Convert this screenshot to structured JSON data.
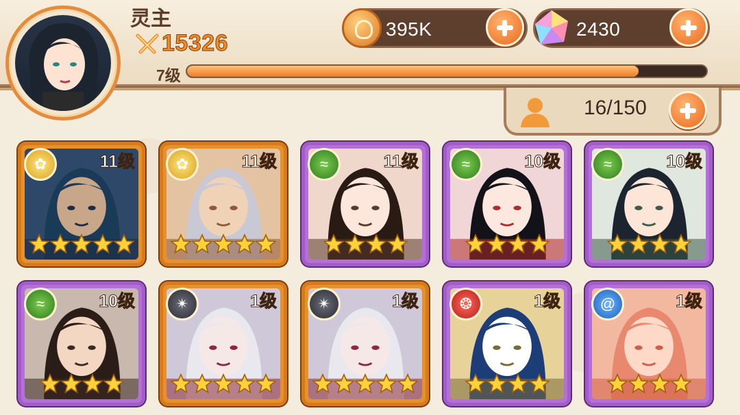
{
  "player": {
    "name": "灵主",
    "power": "15326",
    "level": "7级",
    "xp_fraction": 0.87
  },
  "resources": {
    "coins": "395K",
    "gems": "2430",
    "heroes": "16/150"
  },
  "colors": {
    "accent": "#ee7a26",
    "orange_frame": "#e7912d",
    "purple_frame": "#b56fd8"
  },
  "heroes": [
    {
      "level": "11级",
      "stars": 5,
      "frame": "orange",
      "faction": "gold-rose"
    },
    {
      "level": "11级",
      "stars": 5,
      "frame": "orange",
      "faction": "gold-rose"
    },
    {
      "level": "11级",
      "stars": 4,
      "frame": "purple",
      "faction": "green-leaf"
    },
    {
      "level": "10级",
      "stars": 4,
      "frame": "purple",
      "faction": "green-leaf"
    },
    {
      "level": "10级",
      "stars": 4,
      "frame": "purple",
      "faction": "green-leaf"
    },
    {
      "level": "10级",
      "stars": 4,
      "frame": "purple",
      "faction": "green-leaf"
    },
    {
      "level": "1级",
      "stars": 5,
      "frame": "orange",
      "faction": "dark-web"
    },
    {
      "level": "1级",
      "stars": 5,
      "frame": "orange",
      "faction": "dark-web"
    },
    {
      "level": "1级",
      "stars": 4,
      "frame": "purple",
      "faction": "red-flame"
    },
    {
      "level": "1级",
      "stars": 4,
      "frame": "purple",
      "faction": "blue-swirl"
    }
  ]
}
